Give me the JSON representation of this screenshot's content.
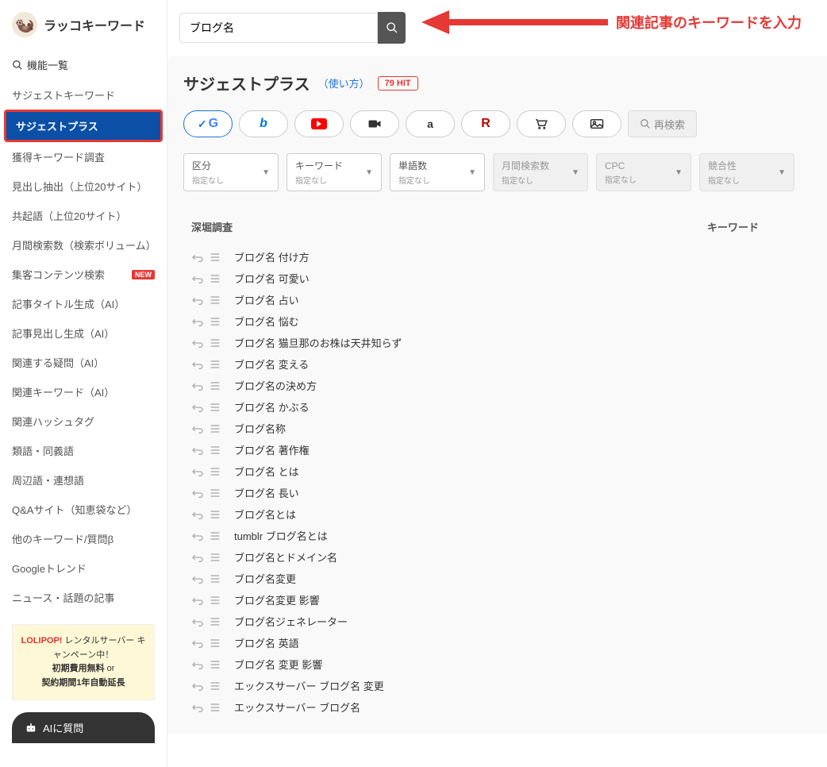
{
  "logo_text": "ラッコキーワード",
  "sidebar": {
    "func_header": "機能一覧",
    "items": [
      {
        "label": "サジェストキーワード",
        "active": false
      },
      {
        "label": "サジェストプラス",
        "active": true
      },
      {
        "label": "獲得キーワード調査",
        "active": false
      },
      {
        "label": "見出し抽出（上位20サイト）",
        "active": false
      },
      {
        "label": "共起語（上位20サイト）",
        "active": false
      },
      {
        "label": "月間検索数（検索ボリューム）",
        "active": false
      },
      {
        "label": "集客コンテンツ検索",
        "active": false,
        "new": true
      },
      {
        "label": "記事タイトル生成（AI）",
        "active": false
      },
      {
        "label": "記事見出し生成（AI）",
        "active": false
      },
      {
        "label": "関連する疑問（AI）",
        "active": false
      },
      {
        "label": "関連キーワード（AI）",
        "active": false
      },
      {
        "label": "関連ハッシュタグ",
        "active": false
      },
      {
        "label": "類語・同義語",
        "active": false
      },
      {
        "label": "周辺語・連想語",
        "active": false
      },
      {
        "label": "Q&Aサイト（知恵袋など）",
        "active": false
      },
      {
        "label": "他のキーワード/質問β",
        "active": false
      },
      {
        "label": "Googleトレンド",
        "active": false
      },
      {
        "label": "ニュース・話題の記事",
        "active": false
      }
    ],
    "ad": {
      "line1_brand": "LOLIPOP!",
      "line1_rest": " レンタルサーバー キャンペーン中！",
      "line2_a": "初期費用無料",
      "line2_b": " or",
      "line3": "契約期間1年自動延長"
    },
    "ai_btn": "AIに質問"
  },
  "search": {
    "value": "ブログ名"
  },
  "annotation": "関連記事のキーワードを入力",
  "page_title": "サジェストプラス",
  "usage_link": "（使い方）",
  "hit_badge": "79 HIT",
  "research_btn": "再検索",
  "new_label": "NEW",
  "filters": [
    {
      "label": "区分",
      "value": "指定なし",
      "disabled": false
    },
    {
      "label": "キーワード",
      "value": "指定なし",
      "disabled": false
    },
    {
      "label": "単語数",
      "value": "指定なし",
      "disabled": false
    },
    {
      "label": "月間検索数",
      "value": "指定なし",
      "disabled": true
    },
    {
      "label": "CPC",
      "value": "指定なし",
      "disabled": true
    },
    {
      "label": "競合性",
      "value": "指定なし",
      "disabled": true
    }
  ],
  "table": {
    "col_deep": "深堀調査",
    "col_kw": "キーワード"
  },
  "results": [
    "ブログ名 付け方",
    "ブログ名 可愛い",
    "ブログ名 占い",
    "ブログ名 悩む",
    "ブログ名 猫旦那のお株は天井知らず",
    "ブログ名 変える",
    "ブログ名の決め方",
    "ブログ名 かぶる",
    "ブログ名称",
    "ブログ名 著作権",
    "ブログ名 とは",
    "ブログ名 長い",
    "ブログ名とは",
    "tumblr ブログ名とは",
    "ブログ名とドメイン名",
    "ブログ名変更",
    "ブログ名変更 影響",
    "ブログ名ジェネレーター",
    "ブログ名 英語",
    "ブログ名 変更 影響",
    "エックスサーバー ブログ名 変更",
    "エックスサーバー ブログ名"
  ]
}
